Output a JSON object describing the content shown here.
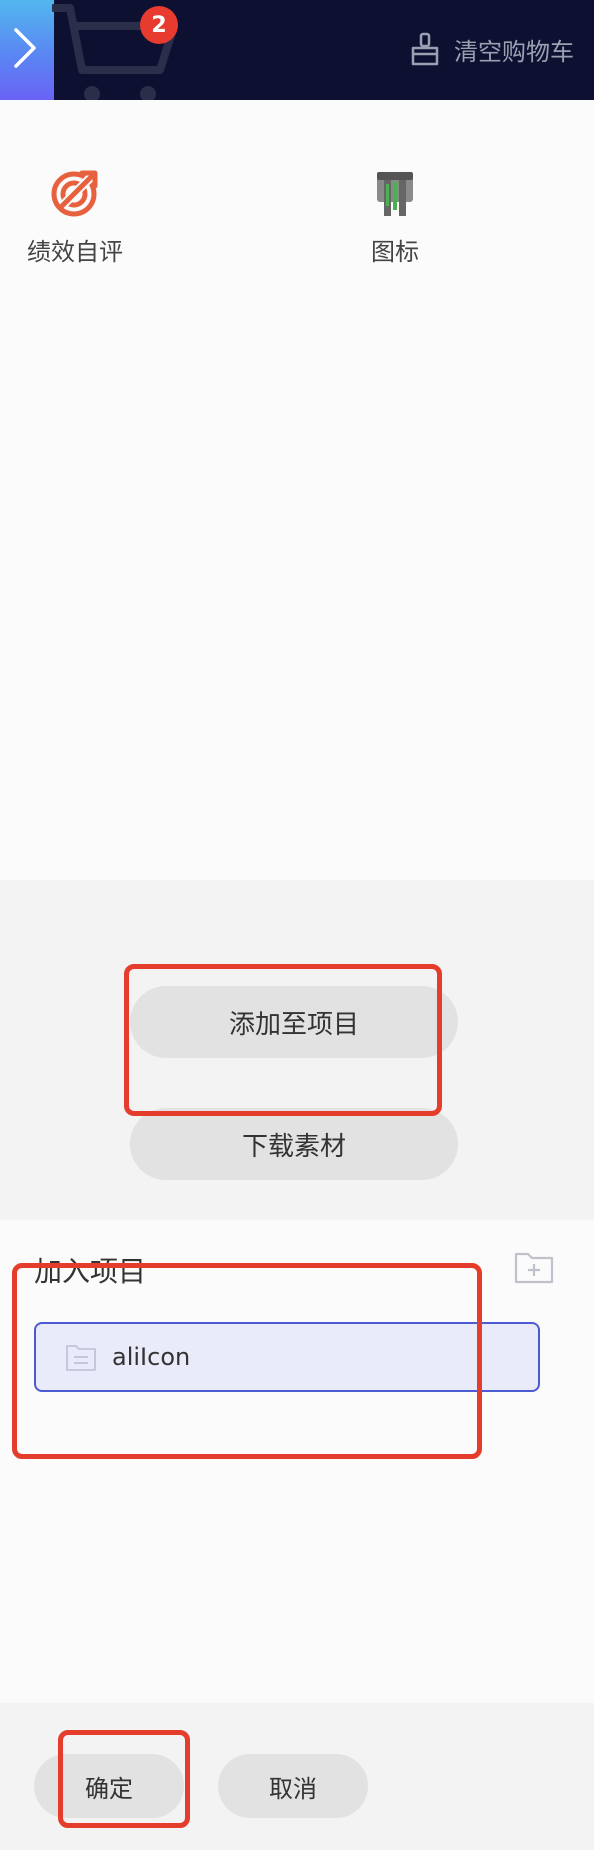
{
  "header": {
    "cart_count": "2",
    "clear_cart_label": "清空购物车"
  },
  "icons": [
    {
      "name": "绩效自评",
      "icon": "performance-rating-icon",
      "color": "#e8613f"
    },
    {
      "name": "图标",
      "icon": "trophy-stand-icon",
      "color": "#555555"
    }
  ],
  "actions": {
    "add_to_project": "添加至项目",
    "download": "下载素材"
  },
  "project": {
    "section_title": "加入项目",
    "items": [
      {
        "name": "aliIcon"
      }
    ]
  },
  "footer": {
    "confirm": "确定",
    "cancel": "取消"
  },
  "colors": {
    "header_bg": "#0d1030",
    "badge": "#e63b2e",
    "annotation": "#e43d2c",
    "selected_border": "#4c5bd4"
  }
}
